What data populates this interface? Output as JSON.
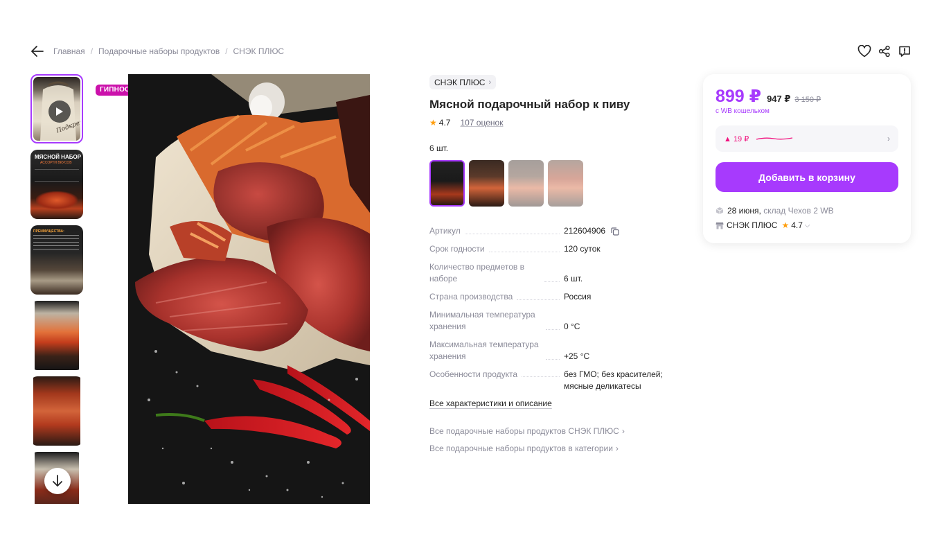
{
  "breadcrumbs": [
    "Главная",
    "Подарочные наборы продуктов",
    "СНЭК ПЛЮС"
  ],
  "badge": "ГИПНОСЕЙЛ",
  "brand": "СНЭК ПЛЮС",
  "title": "Мясной подарочный набор к пиву",
  "rating": "4.7",
  "reviews": "107 оценок",
  "variant_label": "6 шт.",
  "thumb_texts": {
    "t1_title": "МЯСНОЙ НАБОР",
    "t1_sub": "АССОРТИ ВКУСОВ",
    "t2_title": "ПРЕИМУЩЕСТВА:",
    "t0_label": "Подкрепись"
  },
  "specs": [
    {
      "key": "Артикул",
      "value": "212604906"
    },
    {
      "key": "Срок годности",
      "value": "120 суток"
    },
    {
      "key": "Количество предметов в наборе",
      "value": "6 шт."
    },
    {
      "key": "Страна производства",
      "value": "Россия"
    },
    {
      "key": "Минимальная температура хранения",
      "value": "0 °C"
    },
    {
      "key": "Максимальная температура хранения",
      "value": "+25 °C"
    },
    {
      "key": "Особенности продукта",
      "value": "без ГМО; без красителей; мясные деликатесы"
    }
  ],
  "all_characteristics": "Все характеристики и описание",
  "more_links": [
    "Все подарочные наборы продуктов СНЭК ПЛЮС",
    "Все подарочные наборы продуктов в категории"
  ],
  "price": {
    "main": "899 ₽",
    "wb": "947 ₽",
    "old": "3 150 ₽",
    "wallet_note": "с WB кошельком",
    "history_delta": "▲ 19 ₽"
  },
  "cart_button": "Добавить в корзину",
  "delivery": {
    "date": "28 июня,",
    "warehouse": "склад Чехов 2 WB"
  },
  "seller": {
    "name": "СНЭК ПЛЮС",
    "rating": "4.7"
  },
  "colors": {
    "accent": "#a73afd",
    "badge": "#cb11ab",
    "star": "#ff9e0d",
    "price_up": "#f1117e"
  }
}
